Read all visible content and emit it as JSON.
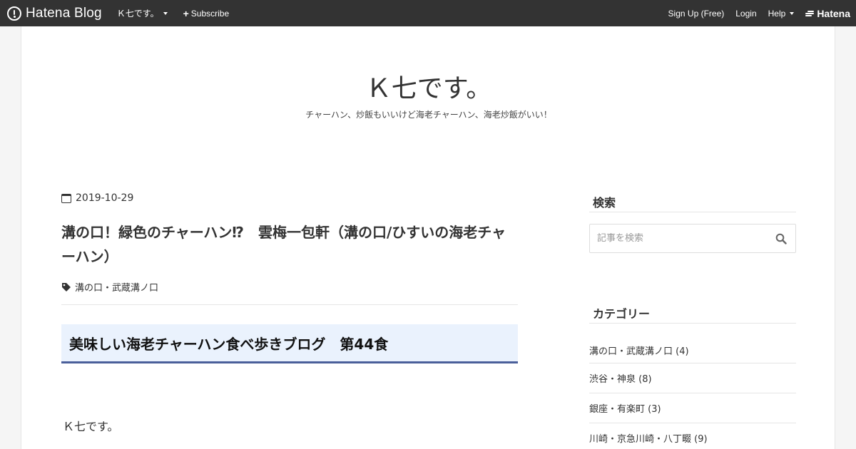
{
  "globalheader": {
    "logo_text": "Hatena Blog",
    "blog_name": "Ｋ七です。",
    "subscribe_label": "Subscribe",
    "signup_label": "Sign Up (Free)",
    "login_label": "Login",
    "help_label": "Help",
    "hatena_label": "Hatena"
  },
  "blog": {
    "title": "Ｋ七です。",
    "description": "チャーハン、炒飯もいいけど海老チャーハン、海老炒飯がいい！"
  },
  "entry": {
    "date": "2019-10-29",
    "title": "溝の口！緑色のチャーハン⁉　雲梅一包軒（溝の口/ひすいの海老チャーハン）",
    "category": "溝の口・武蔵溝ノ口",
    "heading": "美味しい海老チャーハン食べ歩きブログ　第44食",
    "body_first_line": "Ｋ七です。"
  },
  "sidebar": {
    "search": {
      "title": "検索",
      "placeholder": "記事を検索"
    },
    "categories": {
      "title": "カテゴリー",
      "items": [
        {
          "label": "溝の口・武蔵溝ノ口 (4)"
        },
        {
          "label": "渋谷・神泉 (8)"
        },
        {
          "label": "銀座・有楽町 (3)"
        },
        {
          "label": "川崎・京急川崎・八丁畷 (9)"
        }
      ]
    }
  },
  "colors": {
    "header_bg": "#333333",
    "heading_bg": "#eaf2fd",
    "heading_border": "#4a5f9a"
  },
  "icons": [
    "hatena-logo-icon",
    "caret-down-icon",
    "plus-icon",
    "hatena-mark-icon",
    "calendar-icon",
    "tag-icon",
    "search-icon"
  ]
}
